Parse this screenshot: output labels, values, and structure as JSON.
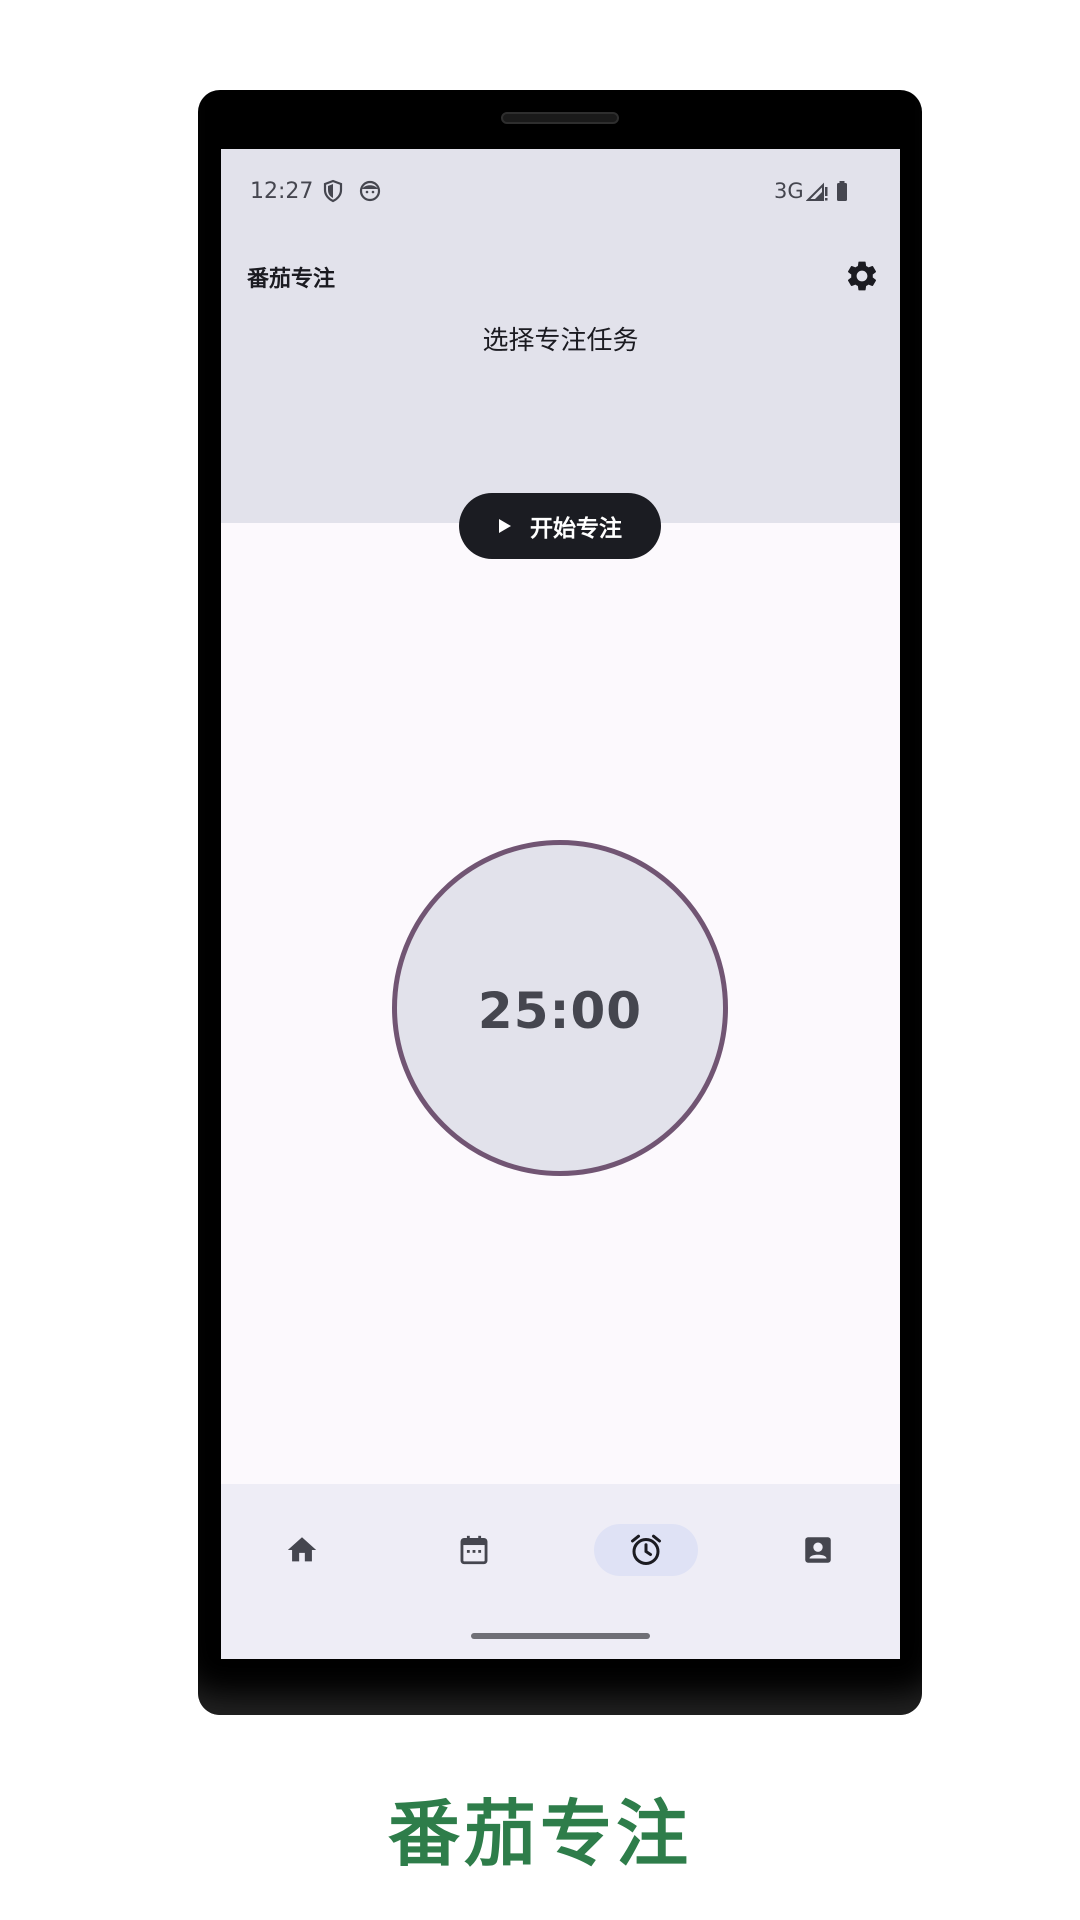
{
  "status_bar": {
    "time": "12:27",
    "network": "3G",
    "icons": [
      "shield-icon",
      "face-icon",
      "signal-icon",
      "battery-icon"
    ]
  },
  "header": {
    "app_title": "番茄专注",
    "task_prompt": "选择专注任务",
    "settings_icon": "gear-icon"
  },
  "start_button": {
    "label": "开始专注",
    "icon": "play-icon"
  },
  "timer": {
    "display": "25:00"
  },
  "bottom_nav": {
    "items": [
      {
        "icon": "home-icon",
        "active": false
      },
      {
        "icon": "calendar-icon",
        "active": false
      },
      {
        "icon": "alarm-clock-icon",
        "active": true
      },
      {
        "icon": "profile-icon",
        "active": false
      }
    ]
  },
  "caption": "番茄专注",
  "colors": {
    "header_bg": "#e2e2eb",
    "screen_bg": "#fcf9fd",
    "timer_ring": "#715573",
    "caption": "#2e7d4a",
    "nav_active": "#dfe2f5"
  }
}
